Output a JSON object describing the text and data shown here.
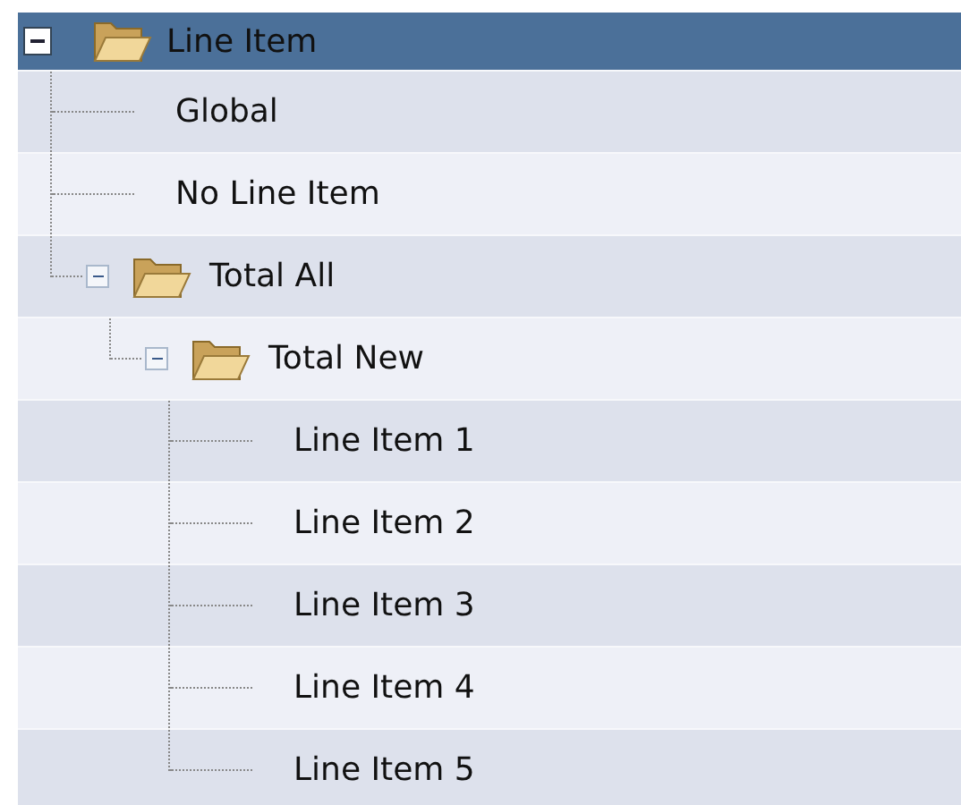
{
  "tree": {
    "label": "Line Item",
    "expanded": true,
    "selected": true,
    "children": [
      {
        "label": "Global",
        "selected": false
      },
      {
        "label": "No Line Item",
        "selected": false
      },
      {
        "label": "Total All",
        "expanded": true,
        "selected": false,
        "children": [
          {
            "label": "Total New",
            "expanded": true,
            "selected": false,
            "children": [
              {
                "label": "Line Item 1",
                "selected": false
              },
              {
                "label": "Line Item 2",
                "selected": false
              },
              {
                "label": "Line Item 3",
                "selected": false
              },
              {
                "label": "Line Item 4",
                "selected": false
              },
              {
                "label": "Line Item 5",
                "selected": false
              }
            ]
          }
        ]
      }
    ]
  }
}
